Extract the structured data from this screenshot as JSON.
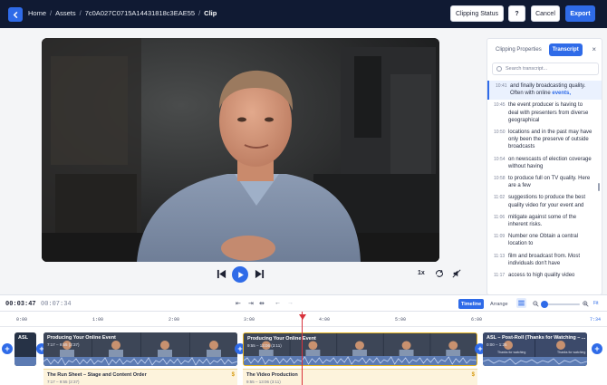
{
  "header": {
    "breadcrumbs": [
      "Home",
      "Assets",
      "7c0A027C0715A14431818c3EAE55"
    ],
    "current": "Clip",
    "separator": "/",
    "buttons": {
      "clipping_status": "Clipping Status",
      "help": "?",
      "cancel": "Cancel",
      "export": "Export"
    }
  },
  "player": {
    "playback_rate": "1x"
  },
  "side_panel": {
    "tabs": [
      "Clipping Properties",
      "Transcript"
    ],
    "active_tab": "Transcript",
    "close": "×",
    "search_placeholder": "Search transcript...",
    "lines": [
      {
        "time": "10:41",
        "pre": "and finally broadcasting quality. Often with online ",
        "highlight": "events,",
        "active": true
      },
      {
        "time": "10:45",
        "text": "the event producer is having to deal with presenters from diverse geographical"
      },
      {
        "time": "10:50",
        "text": "locations and in the past may have only been the preserve of outside broadcasts"
      },
      {
        "time": "10:54",
        "text": "on newscasts of election coverage without having"
      },
      {
        "time": "10:58",
        "text": "to produce full on TV quality. Here are a few"
      },
      {
        "time": "11:02",
        "text": "suggestions to produce the best quality video for your event and"
      },
      {
        "time": "11:06",
        "text": "mitigate against some of the inherent risks."
      },
      {
        "time": "11:09",
        "text": "Number one Obtain a central location to"
      },
      {
        "time": "11:13",
        "text": "film and broadcast from. Most individuals don't have"
      },
      {
        "time": "11:17",
        "text": "access to high quality video"
      }
    ]
  },
  "timeline_bar": {
    "current_time": "00:03:47",
    "total_time": "00:07:34",
    "modes": [
      "Timeline",
      "Arrange"
    ],
    "active_mode": "Timeline",
    "zoom_fit": "Fit",
    "zoom_level_fraction": 0.05
  },
  "timeline": {
    "ruler": [
      "0:00",
      "1:00",
      "2:00",
      "3:00",
      "4:00",
      "5:00",
      "6:00",
      "7:34"
    ],
    "clips": [
      {
        "title": "ASL",
        "time": "",
        "kind": "start"
      },
      {
        "title": "Producing Your Online Event",
        "time": "7:17 – 9:55 (2:37)"
      },
      {
        "title": "Producing Your Online Event",
        "time": "9:55 – 13:06 (3:11)"
      },
      {
        "title": "ASL – Post-Roll (Thanks for Watching – ...",
        "time": "0:00 – 1:25"
      }
    ],
    "cards": [
      {
        "title": "The Run Sheet – Stage and Content Order",
        "time": "7:17 – 9:55 (2:37)"
      },
      {
        "title": "The Video Production",
        "time": "9:55 – 13:06 (3:11)"
      }
    ],
    "thumb_caption": "Thanks for watching"
  }
}
